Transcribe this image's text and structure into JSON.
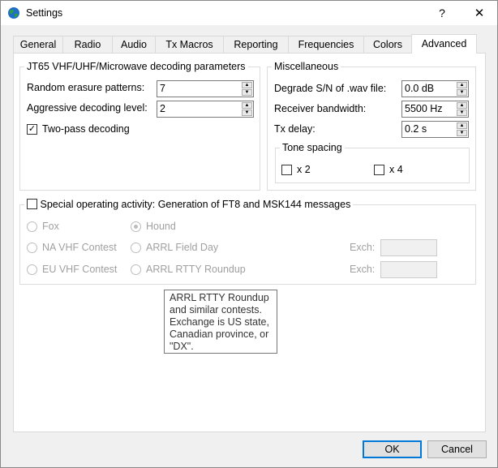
{
  "window": {
    "title": "Settings",
    "help_label": "?",
    "close_label": "✕",
    "icon": "globe-app-icon"
  },
  "tabs": [
    {
      "label": "General"
    },
    {
      "label": "Radio"
    },
    {
      "label": "Audio"
    },
    {
      "label": "Tx Macros"
    },
    {
      "label": "Reporting"
    },
    {
      "label": "Frequencies"
    },
    {
      "label": "Colors"
    },
    {
      "label": "Advanced",
      "active": true
    }
  ],
  "jt65": {
    "title": "JT65 VHF/UHF/Microwave decoding parameters",
    "random_label": "Random erasure patterns:",
    "random_value": "7",
    "aggressive_label": "Aggressive decoding level:",
    "aggressive_value": "2",
    "two_pass_label": "Two-pass decoding",
    "two_pass_checked": true,
    "check_glyph": "✓"
  },
  "misc": {
    "title": "Miscellaneous",
    "degrade_label": "Degrade S/N of .wav file:",
    "degrade_value": "0.0 dB",
    "bandwidth_label": "Receiver bandwidth:",
    "bandwidth_value": "5500  Hz",
    "txdelay_label": "Tx delay:",
    "txdelay_value": "0.2  s",
    "tone_title": "Tone spacing",
    "x2_label": "x 2",
    "x4_label": "x 4"
  },
  "special": {
    "checkbox_label": "Special operating activity:  Generation of FT8 and MSK144 messages",
    "fox": "Fox",
    "hound": "Hound",
    "na_vhf": "NA VHF Contest",
    "arrl_field": "ARRL Field Day",
    "eu_vhf": "EU VHF Contest",
    "arrl_rtty": "ARRL RTTY Roundup",
    "exch_label": "Exch:"
  },
  "tooltip": {
    "text": "ARRL RTTY Roundup\nand similar contests.\nExchange is US state,\nCanadian province, or\n\"DX\"."
  },
  "buttons": {
    "ok": "OK",
    "cancel": "Cancel"
  },
  "colors": {
    "accent": "#0078d7",
    "icon_green": "#2ea043",
    "icon_blue": "#1f6fc5"
  }
}
